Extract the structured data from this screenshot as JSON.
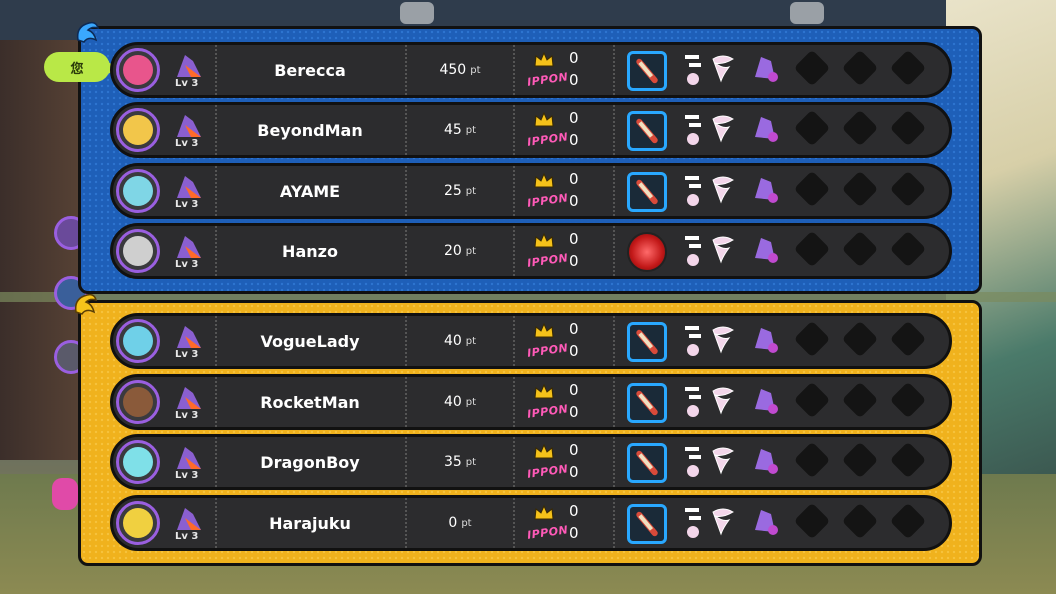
{
  "you_label": "您",
  "point_unit": "pt",
  "ippon_label": "IPPON",
  "teams": [
    {
      "color": "blue",
      "players": [
        {
          "name": "Berecca",
          "level": "Lv 3",
          "points": "450",
          "crowns": "0",
          "ippon": "0",
          "weapon": "bat",
          "avatar": "#e8558c"
        },
        {
          "name": "BeyondMan",
          "level": "Lv 3",
          "points": "45",
          "crowns": "0",
          "ippon": "0",
          "weapon": "bat",
          "avatar": "#f2c64a"
        },
        {
          "name": "AYAME",
          "level": "Lv 3",
          "points": "25",
          "crowns": "0",
          "ippon": "0",
          "weapon": "bat",
          "avatar": "#7fd6e6"
        },
        {
          "name": "Hanzo",
          "level": "Lv 3",
          "points": "20",
          "crowns": "0",
          "ippon": "0",
          "weapon": "yoyo",
          "avatar": "#cfcfcf"
        }
      ]
    },
    {
      "color": "yellow",
      "players": [
        {
          "name": "VogueLady",
          "level": "Lv 3",
          "points": "40",
          "crowns": "0",
          "ippon": "0",
          "weapon": "bat",
          "avatar": "#6fd0e8"
        },
        {
          "name": "RocketMan",
          "level": "Lv 3",
          "points": "40",
          "crowns": "0",
          "ippon": "0",
          "weapon": "bat",
          "avatar": "#8a5a3a"
        },
        {
          "name": "DragonBoy",
          "level": "Lv 3",
          "points": "35",
          "crowns": "0",
          "ippon": "0",
          "weapon": "bat",
          "avatar": "#7fe0e8"
        },
        {
          "name": "Harajuku",
          "level": "Lv 3",
          "points": "0",
          "crowns": "0",
          "ippon": "0",
          "weapon": "bat",
          "avatar": "#f0d040"
        }
      ]
    }
  ],
  "colors": {
    "blue_team": "#1e5fb8",
    "yellow_team": "#f0b21d",
    "row_bg": "#2c2c2e",
    "avatar_ring": "#9a5fe0",
    "ippon": "#ff5ab8",
    "weapon_frame": "#29a8ff"
  }
}
